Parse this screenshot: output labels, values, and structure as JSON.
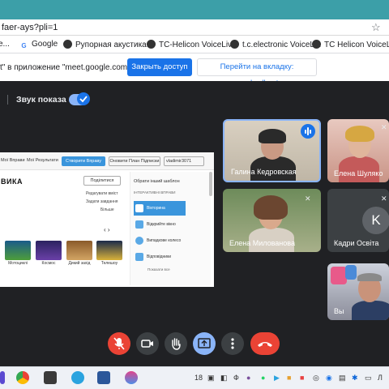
{
  "browser": {
    "url": "faer-ays?pli=1",
    "bookmarks": [
      {
        "label": "е...",
        "icon": "page-icon"
      },
      {
        "label": "Google",
        "icon": "google-icon"
      },
      {
        "label": "Рупорная акустика...",
        "icon": "globe-icon"
      },
      {
        "label": "TC-Helicon VoiceLiv...",
        "icon": "globe-icon"
      },
      {
        "label": "t.c.electronic VoiceL...",
        "icon": "globe-icon"
      },
      {
        "label": "TC Helicon VoiceLiv...",
        "icon": "globe-icon"
      }
    ]
  },
  "notification": {
    "text": "t\" в приложение \"meet.google.com\"...",
    "allow_label": "Закрыть доступ",
    "tab_label": "Перейти на вкладку: wordwall.net"
  },
  "meet": {
    "sound_label": "Звук показа",
    "sound_on": true,
    "participants": [
      {
        "name": "Галина Кедровская",
        "speaking": true
      },
      {
        "name": "Елена Шуляко"
      },
      {
        "name": "Елена Миловановa"
      },
      {
        "name": "Кадри Освіта",
        "avatar_letter": "K"
      },
      {
        "name": "Вы"
      }
    ]
  },
  "presentation": {
    "nav": [
      "Мої Вправи",
      "Мої Результати"
    ],
    "create_label": "Створити Вправу",
    "plan_label": "Оновити План Підписки",
    "user_label": "vladimir3071",
    "title": "ВИКА",
    "share_label": "Поділитися",
    "options": [
      "Редагувати вміст",
      "Задати завдання",
      "Більше"
    ],
    "arrows": "‹  ›",
    "tiles": [
      "Мотоциклі",
      "Космос",
      "Дикий захід",
      "Телешоу"
    ],
    "side_title": "Обрати інший шаблон",
    "side_sub": "ІНТЕРАКТИВНІ ВПРАВИ",
    "templates": [
      "Вікторина",
      "Відкрийте вікно",
      "Випадкове колесо",
      "Відповідники"
    ],
    "show_all": "Показати все"
  },
  "taskbar": {
    "tray": [
      "18",
      "Ф",
      "Л"
    ]
  }
}
